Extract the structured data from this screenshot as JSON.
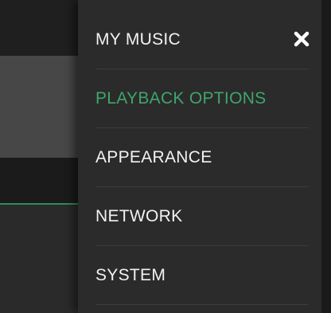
{
  "menu": {
    "items": [
      {
        "label": "MY MUSIC",
        "active": false
      },
      {
        "label": "PLAYBACK OPTIONS",
        "active": true
      },
      {
        "label": "APPEARANCE",
        "active": false
      },
      {
        "label": "NETWORK",
        "active": false
      },
      {
        "label": "SYSTEM",
        "active": false
      }
    ],
    "close_icon": "close-icon"
  },
  "colors": {
    "accent": "#3fa56c",
    "menu_bg": "#2b2b2b",
    "text": "#f2f2f2"
  }
}
